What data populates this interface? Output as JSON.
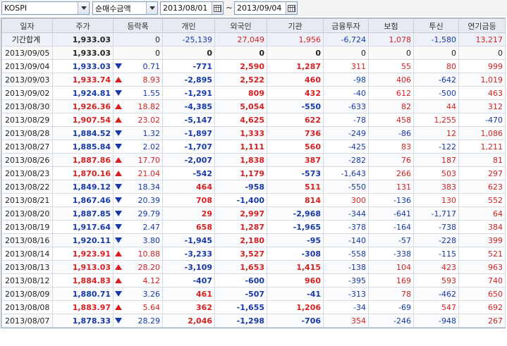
{
  "toolbar": {
    "market_select": "KOSPI",
    "mode_select": "순매수금액",
    "date_from": "2013/08/01",
    "date_separator": "~",
    "date_to": "2013/09/04"
  },
  "colors": {
    "up": "#d61f1f",
    "down": "#1638a8",
    "header_bg": "#e6ebf2"
  },
  "table": {
    "columns": [
      "일자",
      "주가",
      "등락폭",
      "개인",
      "외국인",
      "기관",
      "금융투자",
      "보험",
      "투신",
      "연기금등"
    ],
    "summary": {
      "label": "기간합계",
      "price": "1,933.03",
      "change": "0",
      "individual": "-25,139",
      "foreign": "27,049",
      "institution": "1,956",
      "fin_invest": "-6,724",
      "insurance": "1,078",
      "trust": "-1,580",
      "pension": "13,217"
    },
    "rows": [
      {
        "date": "2013/09/05",
        "price": "1,933.03",
        "dir": "flat",
        "change": "0",
        "individual": "0",
        "foreign": "0",
        "institution": "0",
        "fin_invest": "0",
        "insurance": "0",
        "trust": "0",
        "pension": "0"
      },
      {
        "date": "2013/09/04",
        "price": "1,933.03",
        "dir": "dn",
        "change": "0.71",
        "individual": "-771",
        "foreign": "2,590",
        "institution": "1,287",
        "fin_invest": "311",
        "insurance": "55",
        "trust": "80",
        "pension": "999"
      },
      {
        "date": "2013/09/03",
        "price": "1,933.74",
        "dir": "up",
        "change": "8.93",
        "individual": "-2,895",
        "foreign": "2,522",
        "institution": "460",
        "fin_invest": "-98",
        "insurance": "406",
        "trust": "-642",
        "pension": "1,019"
      },
      {
        "date": "2013/09/02",
        "price": "1,924.81",
        "dir": "dn",
        "change": "1.55",
        "individual": "-1,291",
        "foreign": "809",
        "institution": "432",
        "fin_invest": "-40",
        "insurance": "612",
        "trust": "-500",
        "pension": "463"
      },
      {
        "date": "2013/08/30",
        "price": "1,926.36",
        "dir": "up",
        "change": "18.82",
        "individual": "-4,385",
        "foreign": "5,054",
        "institution": "-550",
        "fin_invest": "-633",
        "insurance": "82",
        "trust": "44",
        "pension": "312"
      },
      {
        "date": "2013/08/29",
        "price": "1,907.54",
        "dir": "up",
        "change": "23.02",
        "individual": "-5,147",
        "foreign": "4,625",
        "institution": "622",
        "fin_invest": "-78",
        "insurance": "458",
        "trust": "1,255",
        "pension": "-470"
      },
      {
        "date": "2013/08/28",
        "price": "1,884.52",
        "dir": "dn",
        "change": "1.32",
        "individual": "-1,897",
        "foreign": "1,333",
        "institution": "736",
        "fin_invest": "-249",
        "insurance": "-86",
        "trust": "12",
        "pension": "1,086"
      },
      {
        "date": "2013/08/27",
        "price": "1,885.84",
        "dir": "dn",
        "change": "2.02",
        "individual": "-1,707",
        "foreign": "1,111",
        "institution": "560",
        "fin_invest": "-425",
        "insurance": "83",
        "trust": "-122",
        "pension": "1,211"
      },
      {
        "date": "2013/08/26",
        "price": "1,887.86",
        "dir": "up",
        "change": "17.70",
        "individual": "-2,007",
        "foreign": "1,838",
        "institution": "387",
        "fin_invest": "-282",
        "insurance": "76",
        "trust": "187",
        "pension": "81"
      },
      {
        "date": "2013/08/23",
        "price": "1,870.16",
        "dir": "up",
        "change": "21.04",
        "individual": "-542",
        "foreign": "1,179",
        "institution": "-573",
        "fin_invest": "-1,643",
        "insurance": "266",
        "trust": "503",
        "pension": "297"
      },
      {
        "date": "2013/08/22",
        "price": "1,849.12",
        "dir": "dn",
        "change": "18.34",
        "individual": "464",
        "foreign": "-958",
        "institution": "511",
        "fin_invest": "-550",
        "insurance": "131",
        "trust": "383",
        "pension": "623"
      },
      {
        "date": "2013/08/21",
        "price": "1,867.46",
        "dir": "dn",
        "change": "20.39",
        "individual": "708",
        "foreign": "-1,400",
        "institution": "814",
        "fin_invest": "300",
        "insurance": "-136",
        "trust": "130",
        "pension": "552"
      },
      {
        "date": "2013/08/20",
        "price": "1,887.85",
        "dir": "dn",
        "change": "29.79",
        "individual": "29",
        "foreign": "2,997",
        "institution": "-2,968",
        "fin_invest": "-344",
        "insurance": "-641",
        "trust": "-1,717",
        "pension": "64"
      },
      {
        "date": "2013/08/19",
        "price": "1,917.64",
        "dir": "dn",
        "change": "2.47",
        "individual": "658",
        "foreign": "1,287",
        "institution": "-1,965",
        "fin_invest": "-378",
        "insurance": "-164",
        "trust": "-738",
        "pension": "384"
      },
      {
        "date": "2013/08/16",
        "price": "1,920.11",
        "dir": "dn",
        "change": "3.80",
        "individual": "-1,945",
        "foreign": "2,180",
        "institution": "-95",
        "fin_invest": "-140",
        "insurance": "-57",
        "trust": "-228",
        "pension": "399"
      },
      {
        "date": "2013/08/14",
        "price": "1,923.91",
        "dir": "up",
        "change": "10.88",
        "individual": "-3,233",
        "foreign": "3,527",
        "institution": "-308",
        "fin_invest": "-558",
        "insurance": "-338",
        "trust": "-115",
        "pension": "521"
      },
      {
        "date": "2013/08/13",
        "price": "1,913.03",
        "dir": "up",
        "change": "28.20",
        "individual": "-3,109",
        "foreign": "1,653",
        "institution": "1,415",
        "fin_invest": "-138",
        "insurance": "104",
        "trust": "423",
        "pension": "963"
      },
      {
        "date": "2013/08/12",
        "price": "1,884.83",
        "dir": "up",
        "change": "4.12",
        "individual": "-407",
        "foreign": "-600",
        "institution": "960",
        "fin_invest": "-395",
        "insurance": "169",
        "trust": "593",
        "pension": "740"
      },
      {
        "date": "2013/08/09",
        "price": "1,880.71",
        "dir": "dn",
        "change": "3.26",
        "individual": "461",
        "foreign": "-507",
        "institution": "-41",
        "fin_invest": "-313",
        "insurance": "78",
        "trust": "-462",
        "pension": "650"
      },
      {
        "date": "2013/08/08",
        "price": "1,883.97",
        "dir": "up",
        "change": "5.64",
        "individual": "362",
        "foreign": "-1,655",
        "institution": "1,206",
        "fin_invest": "-34",
        "insurance": "-69",
        "trust": "547",
        "pension": "692"
      },
      {
        "date": "2013/08/07",
        "price": "1,878.33",
        "dir": "dn",
        "change": "28.29",
        "individual": "2,046",
        "foreign": "-1,298",
        "institution": "-706",
        "fin_invest": "354",
        "insurance": "-246",
        "trust": "-948",
        "pension": "267"
      }
    ]
  }
}
